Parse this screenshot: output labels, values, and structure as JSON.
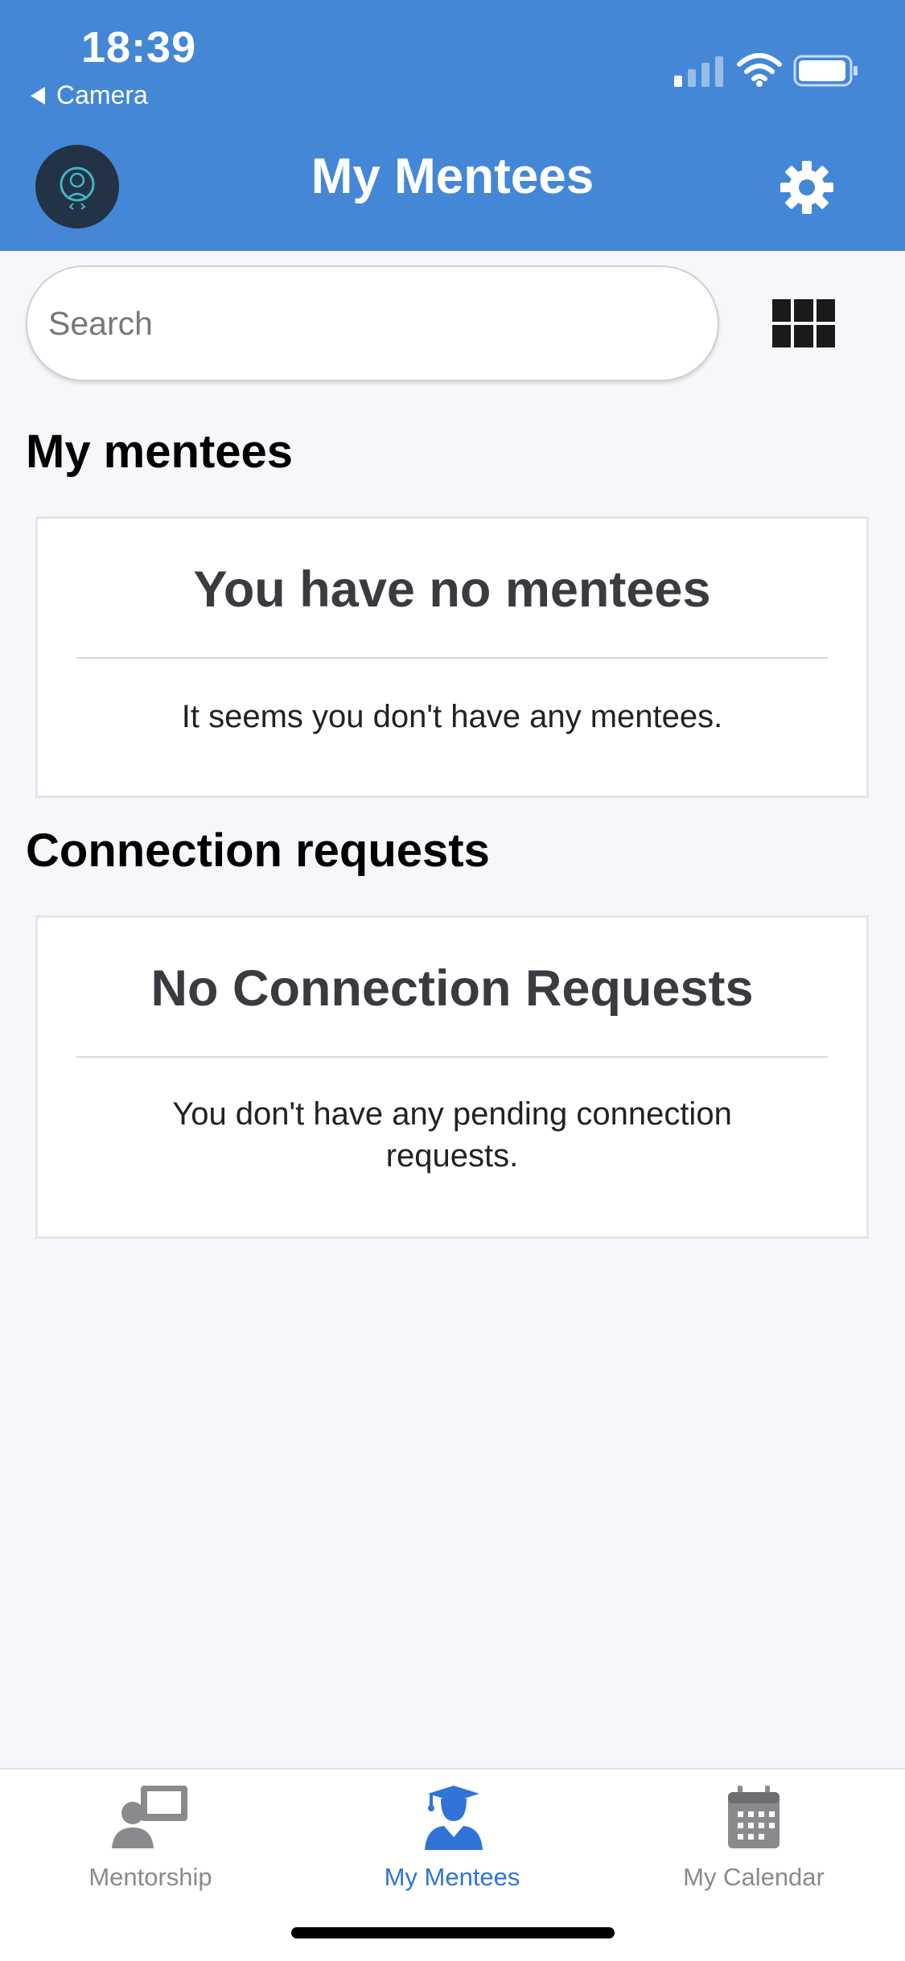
{
  "status_bar": {
    "time": "18:39",
    "back_label": "Camera"
  },
  "header": {
    "title": "My Mentees"
  },
  "search": {
    "placeholder": "Search",
    "value": ""
  },
  "sections": {
    "mentees": {
      "heading": "My mentees",
      "card_title": "You have no mentees",
      "card_text": "It seems you don't have any mentees."
    },
    "connection_requests": {
      "heading": "Connection requests",
      "card_title": "No Connection Requests",
      "card_text": "You don't have any pending connection requests."
    }
  },
  "tabs": [
    {
      "label": "Mentorship",
      "icon": "mentorship-icon",
      "active": false
    },
    {
      "label": "My Mentees",
      "icon": "graduate-icon",
      "active": true
    },
    {
      "label": "My Calendar",
      "icon": "calendar-icon",
      "active": false
    }
  ],
  "colors": {
    "header_bg": "#4487d6",
    "active_tab": "#2f74d6",
    "inactive_tab": "#8a8a8e",
    "page_bg": "#f6f6fb"
  }
}
